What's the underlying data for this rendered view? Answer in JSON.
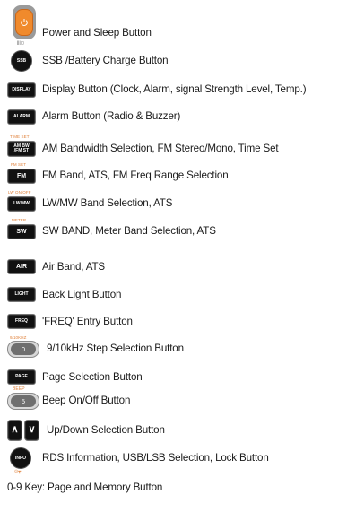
{
  "power": {
    "small_label": "|||▢",
    "description": "Power and Sleep Button"
  },
  "ssb": {
    "key_label": "SSB",
    "description": "SSB /Battery Charge Button"
  },
  "display": {
    "key_label": "DISPLAY",
    "description": "Display Button (Clock, Alarm, signal Strength Level, Temp.)"
  },
  "alarm": {
    "key_label": "ALARM",
    "description": "Alarm Button (Radio & Buzzer)"
  },
  "am_bw": {
    "caption": "TIME SET",
    "key_label_1": "AM BW",
    "key_label_2": "/FM ST",
    "description": "AM Bandwidth Selection, FM Stereo/Mono, Time Set"
  },
  "fm": {
    "caption": "FM SET",
    "key_label": "FM",
    "description": "FM Band, ATS, FM Freq Range Selection"
  },
  "lw_mw": {
    "caption": "LW ON/OFF",
    "key_label": "LW/MW",
    "description": "LW/MW Band Selection, ATS"
  },
  "sw": {
    "caption": "METER",
    "key_label": "SW",
    "description": "SW BAND, Meter Band Selection, ATS"
  },
  "air": {
    "key_label": "AIR",
    "description": "Air Band, ATS"
  },
  "light": {
    "key_label": "LIGHT",
    "description": "Back Light Button"
  },
  "freq": {
    "key_label": "FREQ",
    "description": "'FREQ' Entry Button"
  },
  "step": {
    "caption": "9/10KHZ",
    "key_label": "0",
    "description": "9/10kHz Step Selection Button"
  },
  "page": {
    "key_label": "PAGE",
    "description": "Page Selection Button"
  },
  "beep": {
    "caption": "BEEP",
    "key_label": "5",
    "description": "Beep On/Off Button"
  },
  "updown": {
    "up_label": "∧",
    "down_label": "∨",
    "description": "Up/Down Selection Button"
  },
  "info": {
    "key_label": "INFO",
    "lock_label": "⊙┳",
    "description": "RDS Information, USB/LSB Selection, Lock Button"
  },
  "digits": {
    "description": "0-9 Key: Page and Memory Button"
  },
  "colors": {
    "key": "#111111",
    "caption": "#e0823c",
    "power": "#f08a2c"
  }
}
